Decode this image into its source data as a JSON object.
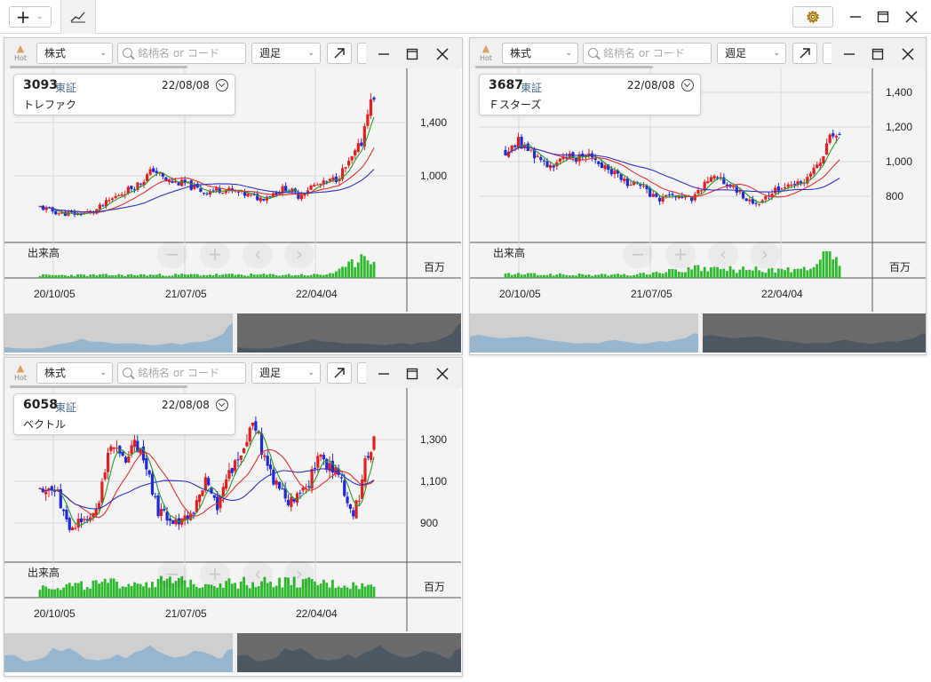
{
  "toolbar": {
    "add_icon": "plus-icon",
    "chart_tab_icon": "line-chart-icon",
    "settings_icon": "gear-icon"
  },
  "panel_toolbar": {
    "hot_label": "Hot",
    "market_select": "株式",
    "search_placeholder": "銘柄名 or コード",
    "period_select": "週足"
  },
  "colors": {
    "up": "#e02020",
    "down": "#1e2ad8",
    "ma_short": "#2a9a2a",
    "ma_mid": "#e03030",
    "ma_long": "#3030c0",
    "volume": "#2eb82e"
  },
  "panels": [
    {
      "code": "3093",
      "exchange": "東証",
      "date": "22/08/08",
      "name": "トレファク",
      "volume_label": "出来高",
      "unit_label": "百万",
      "x_ticks": [
        "20/10/05",
        "21/07/05",
        "22/04/04"
      ],
      "y_ticks": [
        "1,400",
        "1,000"
      ],
      "chart_data": {
        "type": "candlestick",
        "y_ticks": [
          1400,
          1000
        ],
        "x_ticks": [
          "20/10/05",
          "21/07/05",
          "22/04/04"
        ],
        "price_knots": [
          [
            0,
            765
          ],
          [
            6,
            720
          ],
          [
            12,
            715
          ],
          [
            17,
            730
          ],
          [
            25,
            860
          ],
          [
            32,
            950
          ],
          [
            36,
            1050
          ],
          [
            40,
            960
          ],
          [
            46,
            940
          ],
          [
            52,
            880
          ],
          [
            58,
            900
          ],
          [
            65,
            860
          ],
          [
            70,
            830
          ],
          [
            74,
            870
          ],
          [
            78,
            910
          ],
          [
            82,
            850
          ],
          [
            86,
            920
          ],
          [
            90,
            940
          ],
          [
            94,
            980
          ],
          [
            98,
            1090
          ],
          [
            102,
            1250
          ],
          [
            104,
            1500
          ],
          [
            106,
            1600
          ]
        ],
        "volume_knots": [
          [
            0,
            0.1
          ],
          [
            40,
            0.12
          ],
          [
            90,
            0.12
          ],
          [
            96,
            0.3
          ],
          [
            100,
            0.6
          ],
          [
            102,
            0.9
          ],
          [
            104,
            1.0
          ],
          [
            106,
            0.5
          ]
        ]
      }
    },
    {
      "code": "3687",
      "exchange": "東証",
      "date": "22/08/08",
      "name": "Ｆスターズ",
      "volume_label": "出来高",
      "unit_label": "百万",
      "x_ticks": [
        "20/10/05",
        "21/07/05",
        "22/04/04"
      ],
      "y_ticks": [
        "1,400",
        "1,200",
        "1,000",
        "800"
      ],
      "chart_data": {
        "type": "candlestick",
        "y_ticks": [
          1400,
          1200,
          1000,
          800
        ],
        "x_ticks": [
          "20/10/05",
          "21/07/05",
          "22/04/04"
        ],
        "price_knots": [
          [
            0,
            1060
          ],
          [
            4,
            1120
          ],
          [
            8,
            1050
          ],
          [
            14,
            980
          ],
          [
            20,
            1020
          ],
          [
            26,
            1050
          ],
          [
            30,
            990
          ],
          [
            36,
            900
          ],
          [
            42,
            850
          ],
          [
            48,
            780
          ],
          [
            54,
            800
          ],
          [
            58,
            780
          ],
          [
            62,
            870
          ],
          [
            66,
            920
          ],
          [
            70,
            860
          ],
          [
            74,
            800
          ],
          [
            78,
            760
          ],
          [
            82,
            800
          ],
          [
            86,
            870
          ],
          [
            90,
            850
          ],
          [
            94,
            920
          ],
          [
            98,
            980
          ],
          [
            100,
            1080
          ],
          [
            102,
            1180
          ],
          [
            104,
            1150
          ]
        ],
        "volume_knots": [
          [
            0,
            0.15
          ],
          [
            20,
            0.12
          ],
          [
            40,
            0.12
          ],
          [
            60,
            0.35
          ],
          [
            80,
            0.3
          ],
          [
            96,
            0.3
          ],
          [
            100,
            1.0
          ],
          [
            102,
            0.8
          ],
          [
            104,
            0.4
          ]
        ]
      }
    },
    {
      "code": "6058",
      "exchange": "東証",
      "date": "22/08/08",
      "name": "ベクトル",
      "volume_label": "出来高",
      "unit_label": "百万",
      "x_ticks": [
        "20/10/05",
        "21/07/05",
        "22/04/04"
      ],
      "y_ticks": [
        "1,300",
        "1,100",
        "900"
      ],
      "chart_data": {
        "type": "candlestick",
        "y_ticks": [
          1300,
          1100,
          900
        ],
        "x_ticks": [
          "20/10/05",
          "21/07/05",
          "22/04/04"
        ],
        "price_knots": [
          [
            0,
            1060
          ],
          [
            5,
            1080
          ],
          [
            10,
            870
          ],
          [
            16,
            920
          ],
          [
            20,
            1000
          ],
          [
            24,
            1300
          ],
          [
            28,
            1200
          ],
          [
            32,
            1300
          ],
          [
            36,
            1150
          ],
          [
            40,
            950
          ],
          [
            46,
            900
          ],
          [
            52,
            960
          ],
          [
            56,
            1100
          ],
          [
            60,
            960
          ],
          [
            64,
            1150
          ],
          [
            68,
            1230
          ],
          [
            72,
            1400
          ],
          [
            76,
            1200
          ],
          [
            80,
            1080
          ],
          [
            84,
            990
          ],
          [
            88,
            1030
          ],
          [
            90,
            1060
          ],
          [
            94,
            1210
          ],
          [
            98,
            1180
          ],
          [
            102,
            1090
          ],
          [
            106,
            960
          ],
          [
            108,
            1000
          ],
          [
            110,
            1220
          ],
          [
            113,
            1290
          ]
        ],
        "volume_knots": [
          [
            0,
            0.4
          ],
          [
            20,
            0.5
          ],
          [
            40,
            0.6
          ],
          [
            60,
            0.55
          ],
          [
            80,
            0.6
          ],
          [
            100,
            0.5
          ],
          [
            113,
            0.4
          ]
        ]
      }
    }
  ]
}
